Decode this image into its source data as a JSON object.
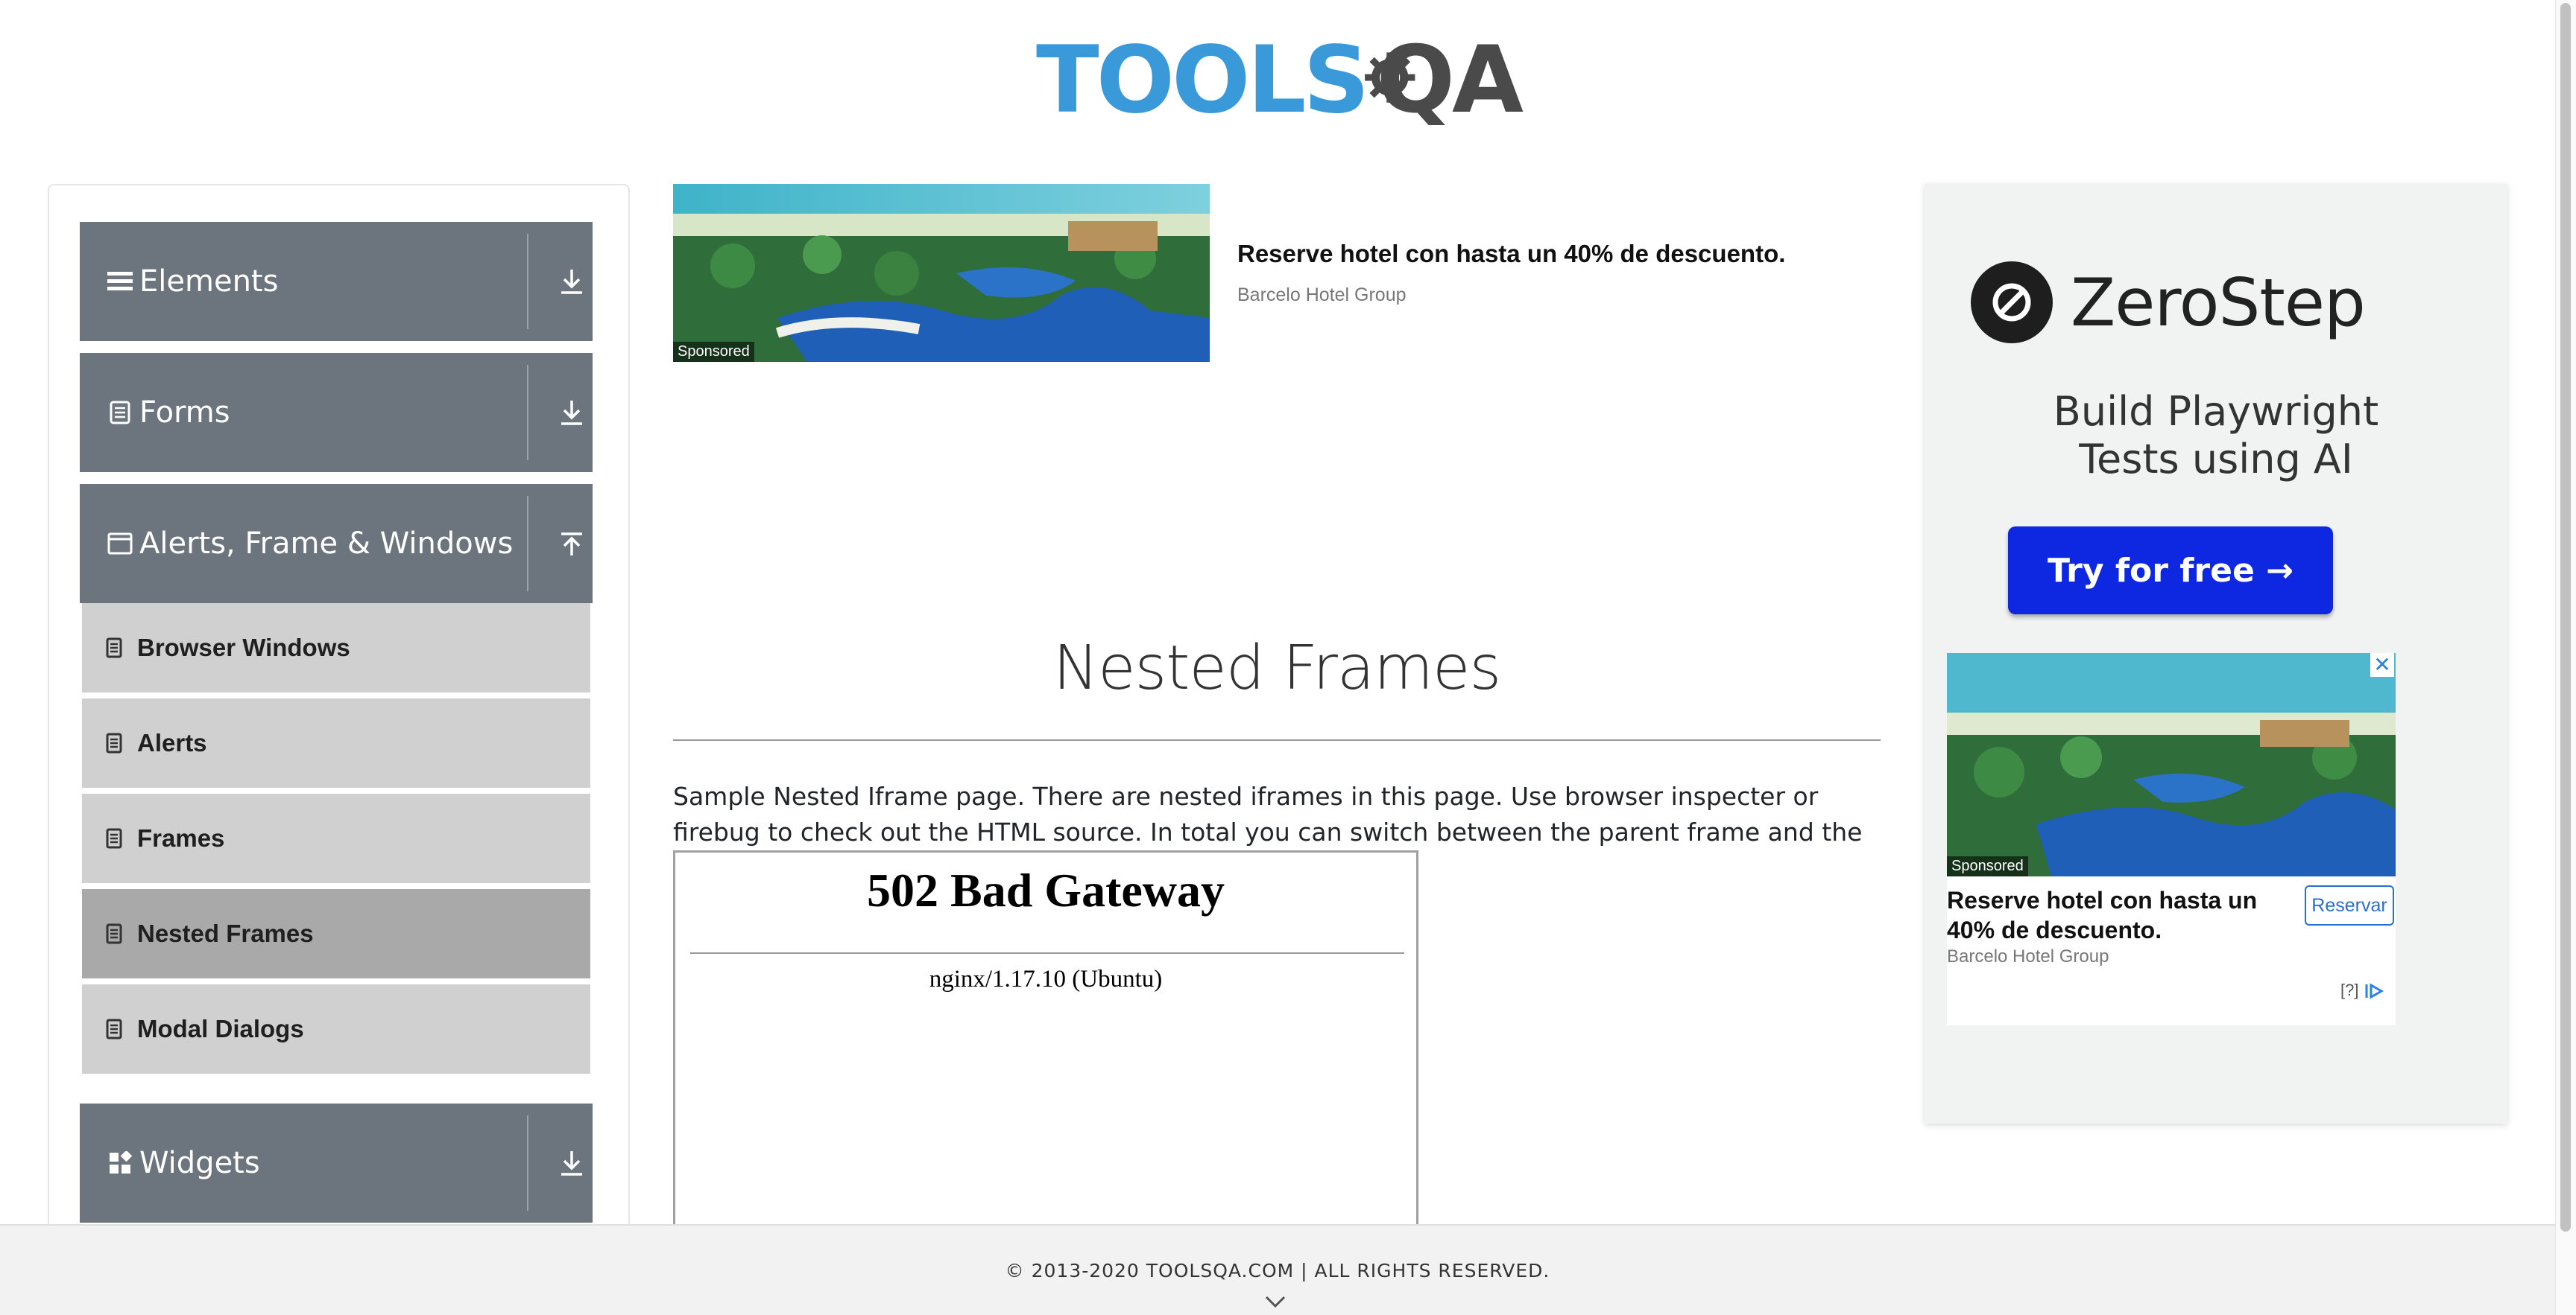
{
  "header": {
    "logo_text_left": "TOOLS",
    "logo_text_right": "QA"
  },
  "sidebar": {
    "groups": [
      {
        "label": "Elements",
        "icon": "menu-icon",
        "toggle": "download-arrow-icon"
      },
      {
        "label": "Forms",
        "icon": "form-icon",
        "toggle": "download-arrow-icon"
      },
      {
        "label": "Alerts, Frame & Windows",
        "icon": "window-icon",
        "toggle": "upload-arrow-icon"
      },
      {
        "label": "Widgets",
        "icon": "widgets-icon",
        "toggle": "download-arrow-icon"
      }
    ],
    "items": [
      {
        "label": "Browser Windows"
      },
      {
        "label": "Alerts"
      },
      {
        "label": "Frames"
      },
      {
        "label": "Nested Frames",
        "active": true
      },
      {
        "label": "Modal Dialogs"
      }
    ]
  },
  "top_ad": {
    "sponsored": "Sponsored",
    "title": "Reserve hotel con hasta un 40% de descuento.",
    "source": "Barcelo Hotel Group"
  },
  "main": {
    "title": "Nested Frames",
    "description": "Sample Nested Iframe page. There are nested iframes in this page. Use browser inspecter or firebug to check out the HTML source. In total you can switch between the parent frame and the nested child frame.",
    "iframe": {
      "error_title": "502 Bad Gateway",
      "server": "nginx/1.17.10 (Ubuntu)"
    }
  },
  "right_ad": {
    "brand": "ZeroStep",
    "tagline_line1": "Build Playwright",
    "tagline_line2": "Tests using AI",
    "cta": "Try for free →",
    "inner": {
      "close": "✕",
      "sponsored": "Sponsored",
      "title": "Reserve hotel con hasta un 40% de descuento.",
      "source": "Barcelo Hotel Group",
      "button": "Reservar",
      "adchoices": "[?]"
    }
  },
  "footer": {
    "text": "© 2013-2020 TOOLSQA.COM | ALL RIGHTS RESERVED."
  },
  "colors": {
    "sidebar_header": "#6c757d",
    "sub_item": "#d0d0d0",
    "active_item": "#a9a9a9",
    "cta_blue": "#0d28e0",
    "logo_blue": "#3a9ad9"
  }
}
